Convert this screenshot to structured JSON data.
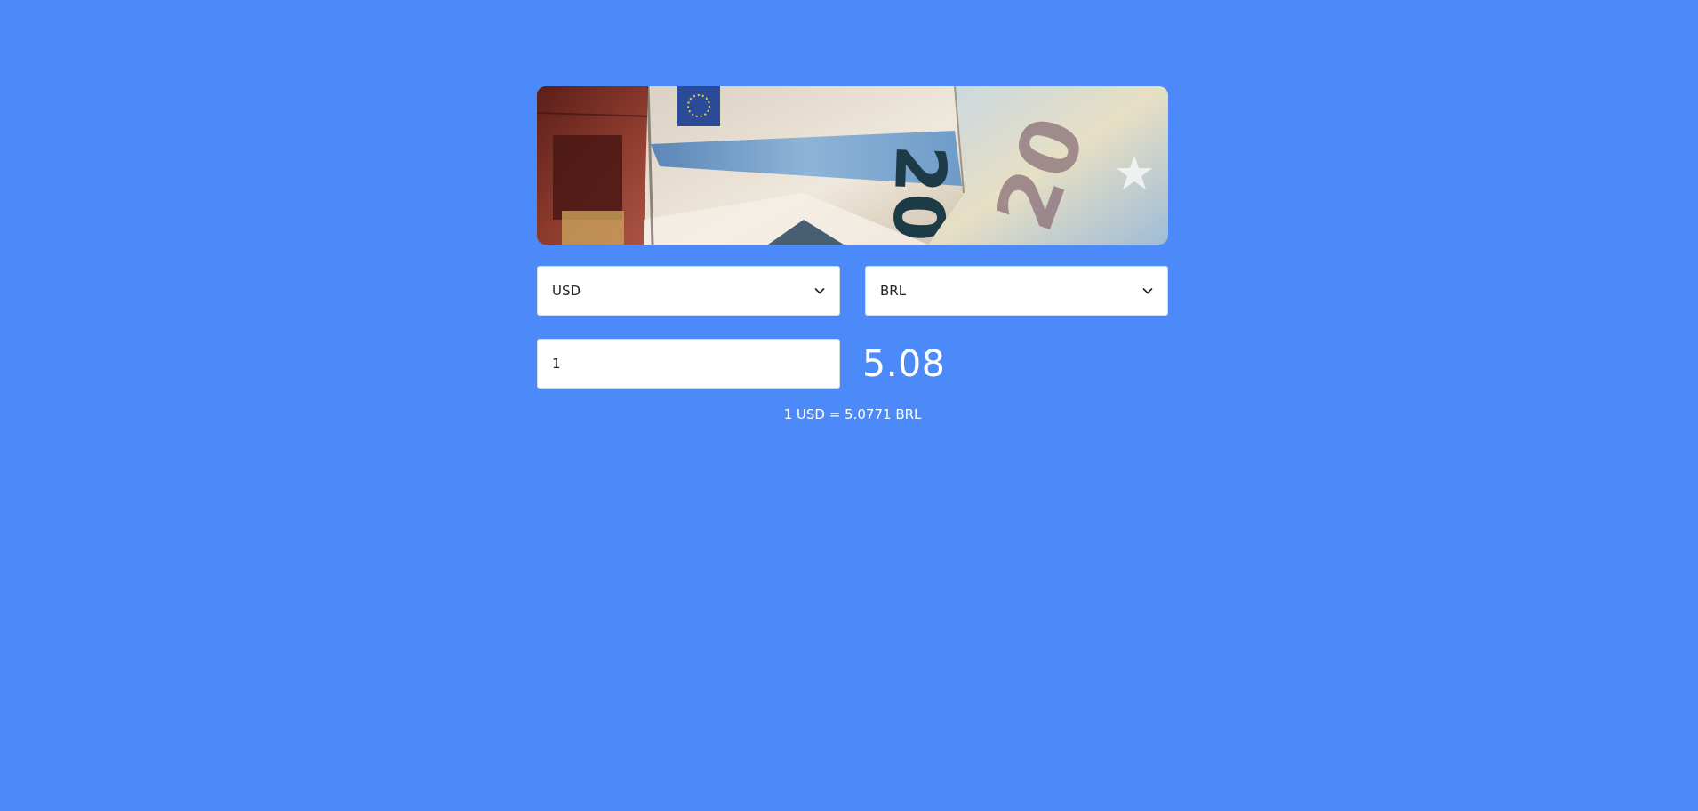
{
  "from_currency": {
    "selected": "USD"
  },
  "to_currency": {
    "selected": "BRL"
  },
  "amount": {
    "value": "1"
  },
  "result": {
    "value": "5.08"
  },
  "rate_text": "1 USD = 5.0771 BRL",
  "colors": {
    "background": "#4b8af8",
    "field_background": "#ffffff",
    "text_light": "#ffffff",
    "text_dark": "#222222"
  },
  "icons": {
    "select_arrow": "chevron-down-icon"
  }
}
